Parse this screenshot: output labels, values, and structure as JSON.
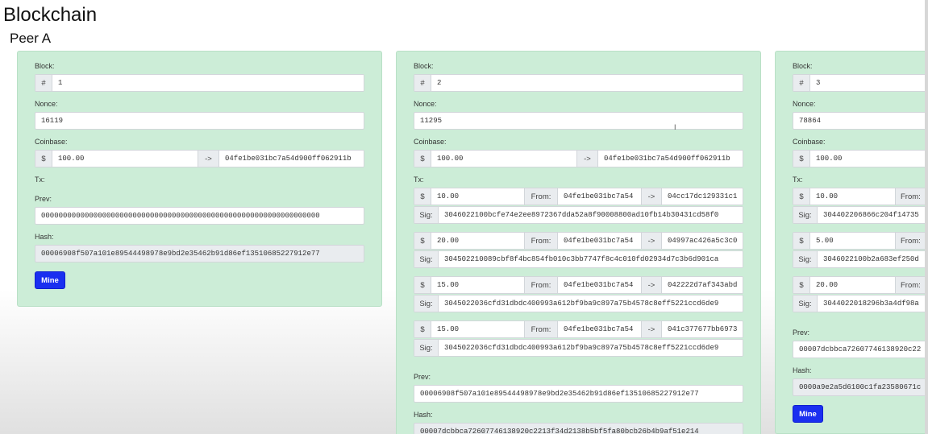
{
  "page": {
    "title": "Blockchain",
    "peer": "Peer A"
  },
  "labels": {
    "block": "Block:",
    "nonce": "Nonce:",
    "coinbase": "Coinbase:",
    "tx": "Tx:",
    "prev": "Prev:",
    "hash": "Hash:",
    "hash_sym": "#",
    "dollar": "$",
    "arrow": "->",
    "from": "From:",
    "sig": "Sig:",
    "mine": "Mine"
  },
  "blocks": [
    {
      "number": "1",
      "nonce": "16119",
      "coinbase": {
        "amount": "100.00",
        "to": "04fe1be031bc7a54d900ff062911b"
      },
      "txs": [],
      "prev": "0000000000000000000000000000000000000000000000000000000000000000",
      "hash": "00006908f507a101e89544498978e9bd2e35462b91d86ef13510685227912e77"
    },
    {
      "number": "2",
      "nonce": "11295",
      "coinbase": {
        "amount": "100.00",
        "to": "04fe1be031bc7a54d900ff062911b"
      },
      "txs": [
        {
          "amount": "10.00",
          "from": "04fe1be031bc7a54",
          "to": "04cc17dc129331c1",
          "sig": "3046022100bcfe74e2ee8972367dda52a8f90008800ad10fb14b30431cd58f0"
        },
        {
          "amount": "20.00",
          "from": "04fe1be031bc7a54",
          "to": "04997ac426a5c3c0",
          "sig": "304502210089cbf8f4bc854fb010c3bb7747f8c4c010fd02934d7c3b6d901ca"
        },
        {
          "amount": "15.00",
          "from": "04fe1be031bc7a54",
          "to": "042222d7af343abd",
          "sig": "3045022036cfd31dbdc400993a612bf9ba9c897a75b4578c8eff5221ccd6de9"
        },
        {
          "amount": "15.00",
          "from": "04fe1be031bc7a54",
          "to": "041c377677bb6973",
          "sig": "3045022036cfd31dbdc400993a612bf9ba9c897a75b4578c8eff5221ccd6de9"
        }
      ],
      "prev": "00006908f507a101e89544498978e9bd2e35462b91d86ef13510685227912e77",
      "hash": "00007dcbbca72607746138920c2213f34d2138b5bf5fa80bcb26b4b9af51e214"
    },
    {
      "number": "3",
      "nonce": "78864",
      "coinbase": {
        "amount": "100.00"
      },
      "txs": [
        {
          "amount": "10.00",
          "sig": "304402206866c204f14735"
        },
        {
          "amount": "5.00",
          "sig": "3046022100b2a683ef250d"
        },
        {
          "amount": "20.00",
          "sig": "3044022018296b3a4df98a"
        }
      ],
      "prev": "00007dcbbca72607746138920c22",
      "hash": "0000a9e2a5d6100c1fa23580671c"
    }
  ]
}
